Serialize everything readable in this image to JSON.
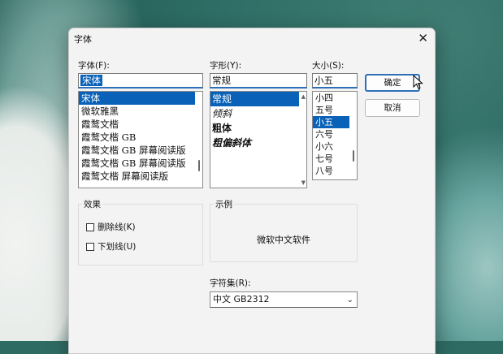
{
  "dialog": {
    "title": "字体",
    "close_glyph": "✕"
  },
  "font": {
    "label": "字体(F):",
    "value": "宋体",
    "items": [
      "宋体",
      "微软雅黑",
      "霞鹜文楷",
      "霞鹜文楷 GB",
      "霞鹜文楷 GB 屏幕阅读版",
      "霞鹜文楷 GB 屏幕阅读版",
      "霞鹜文楷 屏幕阅读版"
    ],
    "selected_index": 0
  },
  "style": {
    "label": "字形(Y):",
    "value": "常规",
    "items": [
      "常规",
      "倾斜",
      "粗体",
      "粗偏斜体"
    ],
    "selected_index": 0
  },
  "size": {
    "label": "大小(S):",
    "value": "小五",
    "items": [
      "小四",
      "五号",
      "小五",
      "六号",
      "小六",
      "七号",
      "八号"
    ],
    "selected_index": 2
  },
  "buttons": {
    "ok": "确定",
    "cancel": "取消"
  },
  "effects": {
    "label": "效果",
    "strikeout": "删除线(K)",
    "underline": "下划线(U)"
  },
  "sample": {
    "label": "示例",
    "text": "微软中文软件"
  },
  "charset": {
    "label": "字符集(R):",
    "value": "中文 GB2312"
  },
  "colors": {
    "accent": "#0a62b8",
    "focus": "#2f6fb5"
  }
}
